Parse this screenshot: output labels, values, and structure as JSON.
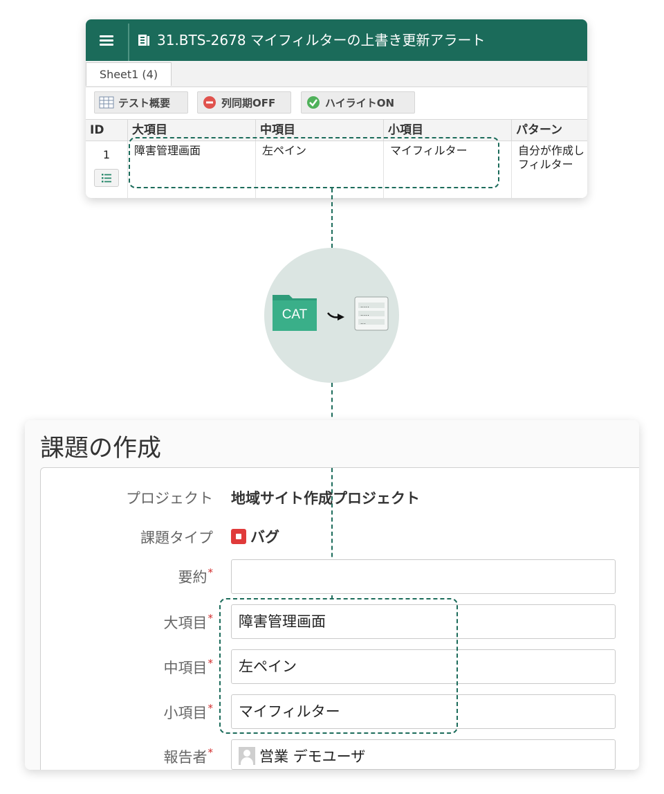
{
  "sheet": {
    "title": "31.BTS-2678 マイフィルターの上書き更新アラート",
    "tab_label": "Sheet1 (4)",
    "toolbar": {
      "test_summary_label": "テスト概要",
      "column_sync_label": "列同期OFF",
      "highlight_label": "ハイライトON"
    },
    "columns": [
      "ID",
      "大項目",
      "中項目",
      "小項目",
      "パターン"
    ],
    "row": {
      "id": "1",
      "major": "障害管理画面",
      "middle": "左ペイン",
      "minor": "マイフィルター",
      "pattern": "自分が作成しフィルター"
    },
    "colors": {
      "header": "#1b6b5a"
    }
  },
  "transfer": {
    "source_label": "CAT",
    "icons": [
      "folder-icon",
      "arrow-icon",
      "document-list-icon"
    ],
    "colors": {
      "folder": "#3aaf89",
      "circle": "#dbe5e2"
    }
  },
  "form": {
    "title": "課題の作成",
    "project": {
      "label": "プロジェクト",
      "value": "地域サイト作成プロジェクト"
    },
    "issue_type": {
      "label": "課題タイプ",
      "value": "バグ"
    },
    "summary": {
      "label": "要約",
      "value": ""
    },
    "major": {
      "label": "大項目",
      "value": "障害管理画面"
    },
    "middle": {
      "label": "中項目",
      "value": "左ペイン"
    },
    "minor": {
      "label": "小項目",
      "value": "マイフィルター"
    },
    "reporter": {
      "label": "報告者",
      "value": "営業 デモユーザ"
    },
    "required_mark": "*"
  }
}
